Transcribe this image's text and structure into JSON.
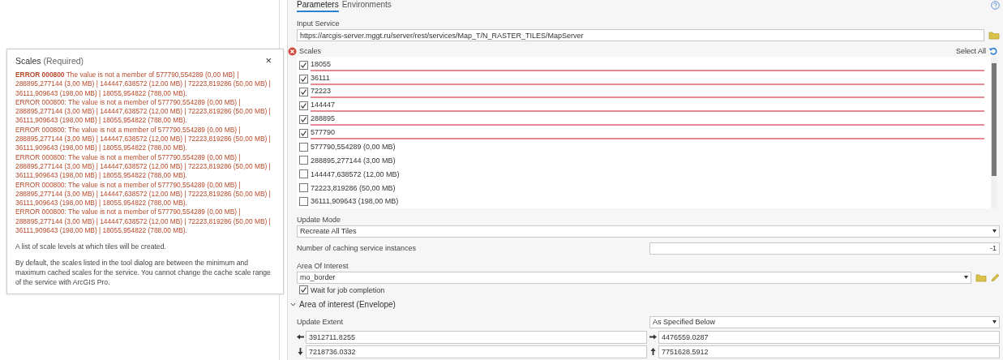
{
  "tooltip": {
    "title": "Scales",
    "qualifier": "(Required)",
    "close": "×",
    "errors": [
      "**ERROR 000800** The value is not a member of 577790,554289 (0,00 MB) | 288895,277144 (3,00 MB) | 144447,638572 (12,00 MB) | 72223,819286 (50,00 MB) | 36111,909643 (198,00 MB) | 18055,954822 (788,00 MB).",
      "ERROR 000800: The value is not a member of 577790,554289 (0,00 MB) | 288895,277144 (3,00 MB) | 144447,638572 (12,00 MB) | 72223,819286 (50,00 MB) | 36111,909643 (198,00 MB) | 18055,954822 (788,00 MB).",
      "ERROR 000800: The value is not a member of 577790,554289 (0,00 MB) | 288895,277144 (3,00 MB) | 144447,638572 (12,00 MB) | 72223,819286 (50,00 MB) | 36111,909643 (198,00 MB) | 18055,954822 (788,00 MB).",
      "ERROR 000800: The value is not a member of 577790,554289 (0,00 MB) | 288895,277144 (3,00 MB) | 144447,638572 (12,00 MB) | 72223,819286 (50,00 MB) | 36111,909643 (198,00 MB) | 18055,954822 (788,00 MB).",
      "ERROR 000800: The value is not a member of 577790,554289 (0,00 MB) | 288895,277144 (3,00 MB) | 144447,638572 (12,00 MB) | 72223,819286 (50,00 MB) | 36111,909643 (198,00 MB) | 18055,954822 (788,00 MB).",
      "ERROR 000800: The value is not a member of 577790,554289 (0,00 MB) | 288895,277144 (3,00 MB) | 144447,638572 (12,00 MB) | 72223,819286 (50,00 MB) | 36111,909643 (198,00 MB) | 18055,954822 (788,00 MB)."
    ],
    "paragraphs": [
      "A list of scale levels at which tiles will be created.",
      "By default, the scales listed in the tool dialog are between the minimum and maximum cached scales for the service. You cannot change the cache scale range of the service with ArcGIS Pro."
    ]
  },
  "tabs": [
    {
      "label": "Parameters",
      "selected": true
    },
    {
      "label": "Environments",
      "selected": false
    }
  ],
  "input_service": {
    "label": "Input Service",
    "value": "https://arcgis-server.mggt.ru/server/rest/services/Map_T/N_RASTER_TILES/MapServer"
  },
  "scales": {
    "label": "Scales",
    "error": true,
    "select_all": "Select All",
    "items": [
      {
        "label": "18055",
        "checked": true,
        "invalid": true
      },
      {
        "label": "36111",
        "checked": true,
        "invalid": true
      },
      {
        "label": "72223",
        "checked": true,
        "invalid": true
      },
      {
        "label": "144447",
        "checked": true,
        "invalid": true
      },
      {
        "label": "288895",
        "checked": true,
        "invalid": true
      },
      {
        "label": "577790",
        "checked": true,
        "invalid": true
      },
      {
        "label": "577790,554289 (0,00 MB)",
        "checked": false,
        "invalid": false
      },
      {
        "label": "288895,277144 (3,00 MB)",
        "checked": false,
        "invalid": false
      },
      {
        "label": "144447,638572 (12,00 MB)",
        "checked": false,
        "invalid": false
      },
      {
        "label": "72223,819286 (50,00 MB)",
        "checked": false,
        "invalid": false
      },
      {
        "label": "36111,909643 (198,00 MB)",
        "checked": false,
        "invalid": false
      }
    ]
  },
  "update_mode": {
    "label": "Update Mode",
    "value": "Recreate All Tiles"
  },
  "instances": {
    "label": "Number of caching service instances",
    "value": "-1"
  },
  "area_of_interest": {
    "label": "Area Of Interest",
    "value": "mo_border"
  },
  "wait": {
    "label": "Wait for job completion",
    "checked": true
  },
  "envelope": {
    "title": "Area of interest (Envelope)",
    "expanded": true,
    "extent_label": "Update Extent",
    "extent_mode": "As Specified Below",
    "coords": [
      {
        "kind": "west",
        "value": "3912711.8255"
      },
      {
        "kind": "east",
        "value": "4476559.0287"
      },
      {
        "kind": "south",
        "value": "7218736.0332"
      },
      {
        "kind": "north",
        "value": "7751628.5912"
      }
    ]
  }
}
